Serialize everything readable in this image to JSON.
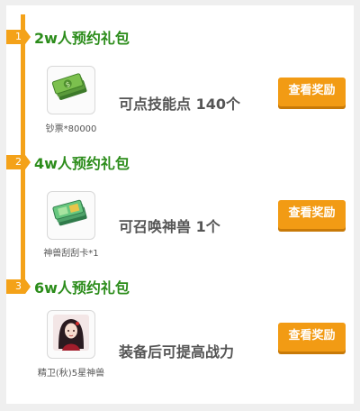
{
  "milestones": [
    {
      "step": "1",
      "title": "2w人预约礼包",
      "item_icon": "banknotes-icon",
      "item_caption": "钞票*80000",
      "description": "可点技能点 140个",
      "button_label": "查看奖励"
    },
    {
      "step": "2",
      "title": "4w人预约礼包",
      "item_icon": "scratch-card-icon",
      "item_caption": "神兽刮刮卡*1",
      "description": "可召唤神兽 1个",
      "button_label": "查看奖励"
    },
    {
      "step": "3",
      "title": "6w人预约礼包",
      "item_icon": "character-portrait-icon",
      "item_caption": "精卫(秋)5星神兽",
      "description": "装备后可提高战力",
      "button_label": "查看奖励"
    }
  ],
  "colors": {
    "accent": "#f4a219",
    "title_green": "#2b8c1a",
    "button": "#f29b14"
  }
}
